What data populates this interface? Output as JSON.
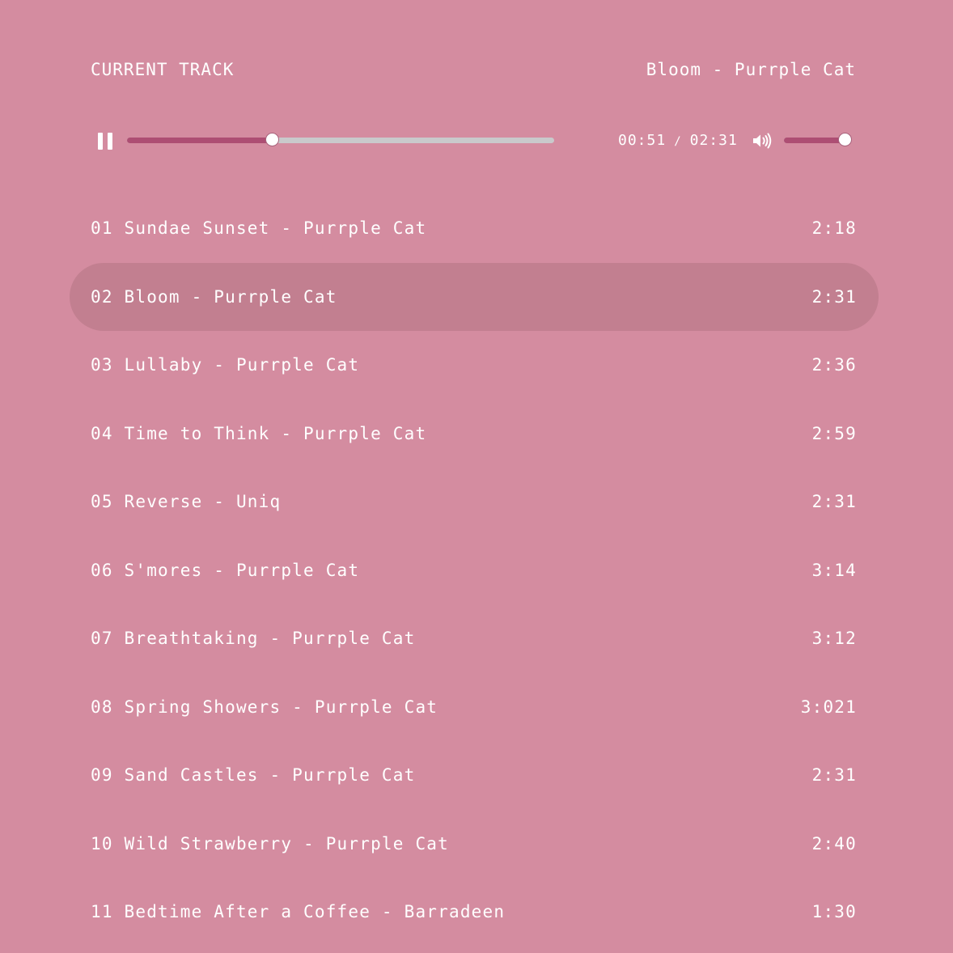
{
  "header": {
    "label": "CURRENT TRACK",
    "now_playing": "Bloom - Purrple Cat"
  },
  "player": {
    "state": "playing",
    "control_icon": "pause-icon",
    "volume_icon": "volume-icon",
    "current_time": "00:51",
    "separator": "/",
    "total_time": "02:31",
    "progress_fraction": 0.34,
    "volume_fraction": 0.97
  },
  "colors": {
    "background": "#d48ca0",
    "accent": "#ad4e73",
    "track_bg": "#c9c9cb",
    "active_row": "#c27f90",
    "text": "#ffffff"
  },
  "playlist": {
    "active_index": 1,
    "tracks": [
      {
        "title": "01 Sundae Sunset - Purrple Cat",
        "duration": "2:18"
      },
      {
        "title": "02 Bloom - Purrple Cat",
        "duration": "2:31"
      },
      {
        "title": "03 Lullaby - Purrple Cat",
        "duration": "2:36"
      },
      {
        "title": "04 Time to Think - Purrple Cat",
        "duration": "2:59"
      },
      {
        "title": "05 Reverse - Uniq",
        "duration": "2:31"
      },
      {
        "title": "06 S'mores - Purrple Cat",
        "duration": "3:14"
      },
      {
        "title": "07 Breathtaking - Purrple Cat",
        "duration": "3:12"
      },
      {
        "title": "08 Spring Showers - Purrple Cat",
        "duration": "3:021"
      },
      {
        "title": "09 Sand Castles - Purrple Cat",
        "duration": "2:31"
      },
      {
        "title": "10 Wild Strawberry - Purrple Cat",
        "duration": "2:40"
      },
      {
        "title": "11 Bedtime After a Coffee - Barradeen",
        "duration": "1:30"
      }
    ]
  }
}
